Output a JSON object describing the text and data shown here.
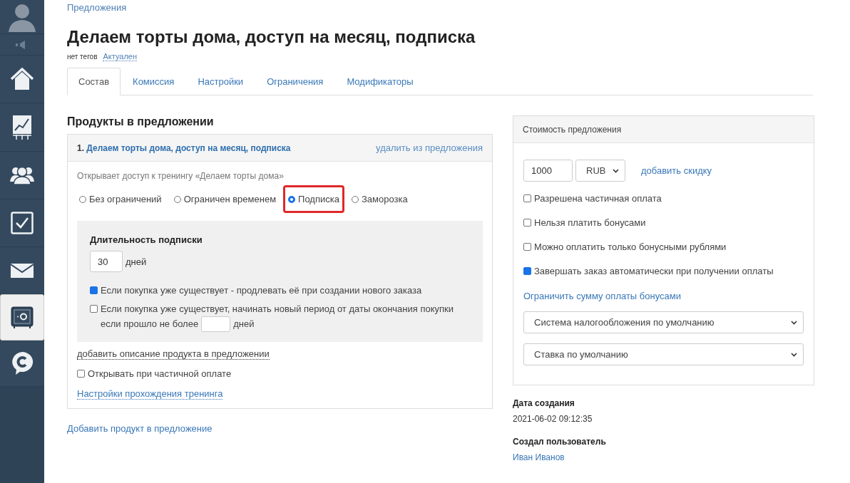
{
  "sidebar": {
    "items": [
      {
        "selected": false
      },
      {
        "selected": false
      },
      {
        "selected": false
      },
      {
        "selected": false
      },
      {
        "selected": false
      },
      {
        "selected": false
      },
      {
        "selected": false
      },
      {
        "selected": true
      },
      {
        "selected": false
      }
    ]
  },
  "breadcrumb": "Предложения",
  "title": "Делаем торты дома, доступ на месяц, подписка",
  "tags": {
    "text": "нет тегов",
    "status": "Актуален"
  },
  "tabs": [
    {
      "label": "Состав",
      "selected": true
    },
    {
      "label": "Комиссия",
      "selected": false
    },
    {
      "label": "Настройки",
      "selected": false
    },
    {
      "label": "Ограничения",
      "selected": false
    },
    {
      "label": "Модификаторы",
      "selected": false
    }
  ],
  "products": {
    "heading": "Продукты в предложении",
    "item": {
      "number": "1.",
      "name": "Делаем торты дома, доступ на месяц, подписка",
      "remove": "удалить из предложения",
      "description": "Открывает доступ к тренингу «Делаем торты дома»",
      "access_options": [
        {
          "label": "Без ограничений",
          "selected": false,
          "highlighted": false
        },
        {
          "label": "Ограничен временем",
          "selected": false,
          "highlighted": false
        },
        {
          "label": "Подписка",
          "selected": true,
          "highlighted": true
        },
        {
          "label": "Заморозка",
          "selected": false,
          "highlighted": false
        }
      ],
      "subscription": {
        "heading": "Длительность подписки",
        "duration": "30",
        "unit": "дней",
        "extend": {
          "label": "Если покупка уже существует - продлевать её при создании нового заказа",
          "checked": true
        },
        "new_period": {
          "label_1": "Если покупка уже существует, начинать новый период от даты окончания покупки",
          "label_2": "если прошло не более",
          "unit": "дней",
          "checked": false
        }
      },
      "add_description": "добавить описание продукта в предложении",
      "open_on_partial": {
        "label": "Открывать при частичной оплате",
        "checked": false
      },
      "training_settings": "Настройки прохождения тренинга"
    },
    "add_product": "Добавить продукт в предложение"
  },
  "price": {
    "heading": "Стоимость предложения",
    "amount": "1000",
    "currency": "RUB",
    "add_discount": "добавить скидку",
    "options": [
      {
        "label": "Разрешена частичная оплата",
        "checked": false
      },
      {
        "label": "Нельзя платить бонусами",
        "checked": false
      },
      {
        "label": "Можно оплатить только бонусными рублями",
        "checked": false
      },
      {
        "label": "Завершать заказ автоматически при получении оплаты",
        "checked": true
      }
    ],
    "limit_bonus": "Ограничить сумму оплаты бонусами",
    "tax_system": "Система налогообложения по умолчанию",
    "tax_rate": "Ставка по умолчанию"
  },
  "meta": [
    {
      "label": "Дата создания",
      "value": "2021-06-02 09:12:35",
      "kind": "text"
    },
    {
      "label": "Создал пользователь",
      "value": "Иван Иванов",
      "kind": "link"
    }
  ]
}
